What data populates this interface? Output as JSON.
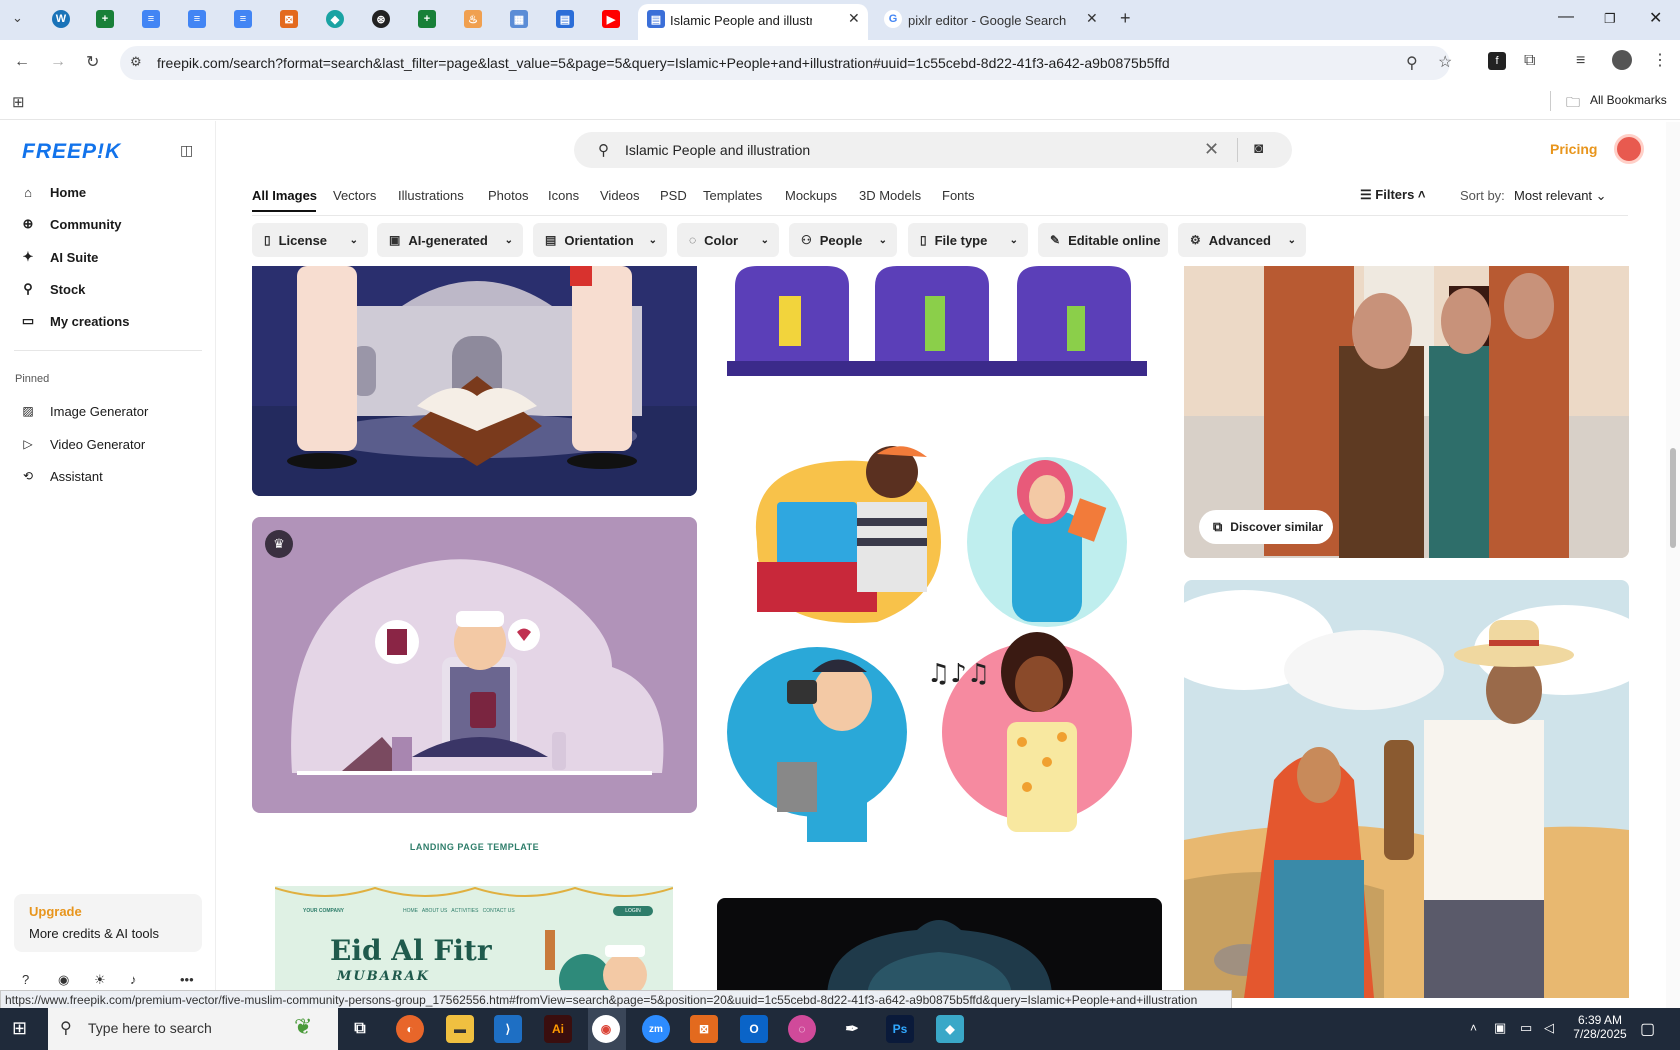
{
  "browser": {
    "active_tab_title": "Islamic People and illustration v",
    "second_tab_title": "pixlr editor - Google Search",
    "url": "freepik.com/search?format=search&last_filter=page&last_value=5&page=5&query=Islamic+People+and+illustration#uuid=1c55cebd-8d22-41f3-a642-a9b0875b5ffd",
    "all_bookmarks": "All Bookmarks",
    "status_url": "https://www.freepik.com/premium-vector/five-muslim-community-persons-group_17562556.htm#fromView=search&page=5&position=20&uuid=1c55cebd-8d22-41f3-a642-a9b0875b5ffd&query=Islamic+People+and+illustration"
  },
  "sidebar": {
    "logo": "FREEP!K",
    "nav": [
      "Home",
      "Community",
      "AI Suite",
      "Stock",
      "My creations"
    ],
    "pinned_label": "Pinned",
    "pinned": [
      "Image Generator",
      "Video Generator",
      "Assistant"
    ],
    "upgrade_title": "Upgrade",
    "upgrade_sub": "More credits & AI tools"
  },
  "header": {
    "search_value": "Islamic People and illustration",
    "pricing": "Pricing"
  },
  "categories": [
    "All Images",
    "Vectors",
    "Illustrations",
    "Photos",
    "Icons",
    "Videos",
    "PSD",
    "Templates",
    "Mockups",
    "3D Models",
    "Fonts"
  ],
  "filters_label": "Filters",
  "sort_label": "Sort by:",
  "sort_value": "Most relevant",
  "chips": [
    "License",
    "AI-generated",
    "Orientation",
    "Color",
    "People",
    "File type",
    "Editable online",
    "Advanced"
  ],
  "cards": {
    "discover_similar": "Discover similar",
    "landing_label": "LANDING PAGE TEMPLATE",
    "eid_title": "Eid Al Fitr",
    "eid_sub": "MUBARAK",
    "eid_nav": "YOUR COMPANY",
    "eid_menu": "HOME   ABOUT US   ACTIVITIES   CONTACT US",
    "eid_login": "LOGIN"
  },
  "taskbar": {
    "search_placeholder": "Type here to search",
    "time": "6:39 AM",
    "date": "7/28/2025"
  }
}
